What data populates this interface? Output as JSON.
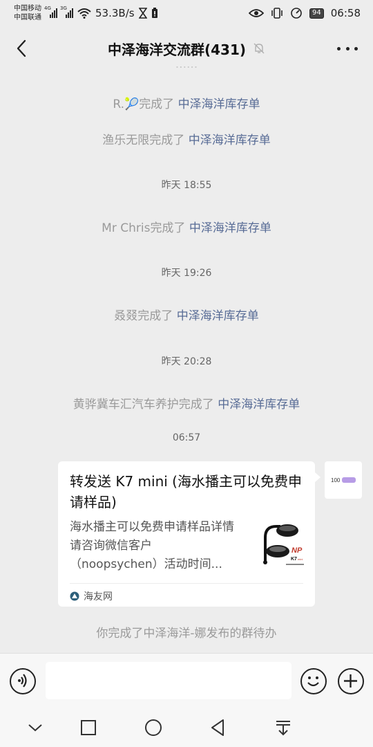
{
  "status": {
    "carrier1": "中国移动",
    "carrier2": "中国联通",
    "sig1_tag": "4G",
    "sig2_tag": "3G",
    "speed": "53.3B/s",
    "battery": "94",
    "time": "06:58"
  },
  "header": {
    "title": "中泽海洋交流群(431)"
  },
  "messages": {
    "m1": {
      "name": "R.🎾",
      "action": "完成了",
      "link": "中泽海洋库存单"
    },
    "m2": {
      "name": "渔乐无限",
      "action": "完成了",
      "link": "中泽海洋库存单"
    },
    "t1": "昨天 18:55",
    "m3": {
      "name": "Mr Chris",
      "action": "完成了",
      "link": "中泽海洋库存单"
    },
    "t2": "昨天 19:26",
    "m4": {
      "name": "叒叕",
      "action": "完成了",
      "link": "中泽海洋库存单"
    },
    "t3": "昨天 20:28",
    "m5": {
      "name": "黄骅冀车汇汽车养护",
      "action": "完成了",
      "link": "中泽海洋库存单"
    },
    "t4": "06:57",
    "last": "你完成了中泽海洋-娜发布的群待办"
  },
  "card": {
    "title": "转发送 K7 mini (海水播主可以免费申请样品)",
    "desc": "海水播主可以免费申请样品详情请咨询微信客户（noopsychen）活动时间...",
    "source": "海友网",
    "thumb_brand": "K7",
    "thumb_sub": "mini"
  },
  "avatar_text": "100"
}
